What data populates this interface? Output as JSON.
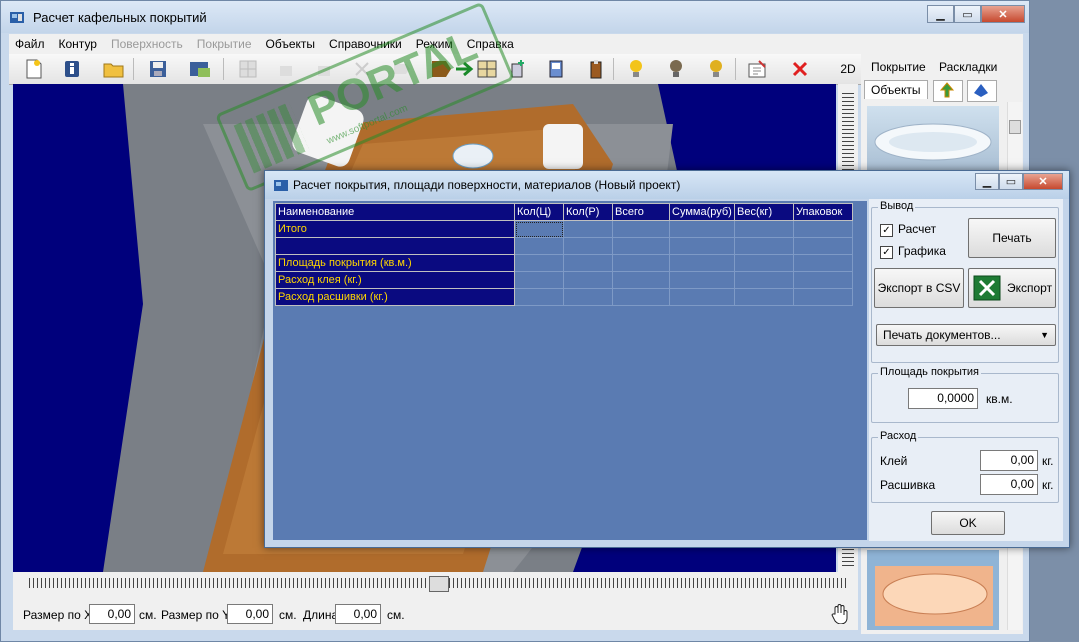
{
  "app": {
    "title": "Расчет кафельных покрытий",
    "caption_min": "▁",
    "caption_max": "▭",
    "caption_close": "✕"
  },
  "menu": [
    {
      "label": "Файл",
      "disabled": false
    },
    {
      "label": "Контур",
      "disabled": false
    },
    {
      "label": "Поверхность",
      "disabled": true
    },
    {
      "label": "Покрытие",
      "disabled": true
    },
    {
      "label": "Объекты",
      "disabled": false
    },
    {
      "label": "Справочники",
      "disabled": false
    },
    {
      "label": "Режим",
      "disabled": false
    },
    {
      "label": "Справка",
      "disabled": false
    }
  ],
  "toolbar": {
    "mode_2d": "2D"
  },
  "right_panel": {
    "tab_coverage": "Покрытие",
    "tab_layouts": "Раскладки",
    "tab_objects": "Объекты"
  },
  "statusbar": {
    "size_x_label": "Размер по X",
    "size_x_value": "0,00",
    "size_x_unit": "см.",
    "size_y_label": "Размер по Y",
    "size_y_value": "0,00",
    "size_y_unit": "см.",
    "length_label": "Длина",
    "length_value": "0,00",
    "length_unit": "см."
  },
  "watermark": {
    "text": "PORTAL",
    "subtext": "www.softportal.com"
  },
  "dialog": {
    "title": "Расчет покрытия, площади поверхности, материалов (Новый проект)",
    "table": {
      "headers": [
        "Наименование",
        "Кол(Ц)",
        "Кол(Р)",
        "Всего",
        "Сумма(руб)",
        "Вес(кг)",
        "Упаковок"
      ],
      "rows": [
        "Итого",
        "",
        "Площадь покрытия (кв.м.)",
        "Расход клея (кг.)",
        "Расход расшивки (кг.)"
      ]
    },
    "output_group": "Вывод",
    "chk_calc": "Расчет",
    "chk_graph": "Графика",
    "chk_calc_checked": true,
    "chk_graph_checked": true,
    "print_button": "Печать",
    "export_csv_button": "Экспорт в CSV",
    "export_excel_button": "Экспорт",
    "print_docs_select": "Печать документов...",
    "area_group": "Площадь покрытия",
    "area_value": "0,0000",
    "area_unit": "кв.м.",
    "consumption_group": "Расход",
    "glue_label": "Клей",
    "glue_value": "0,00",
    "glue_unit": "кг.",
    "grout_label": "Расшивка",
    "grout_value": "0,00",
    "grout_unit": "кг.",
    "ok_button": "OK"
  }
}
